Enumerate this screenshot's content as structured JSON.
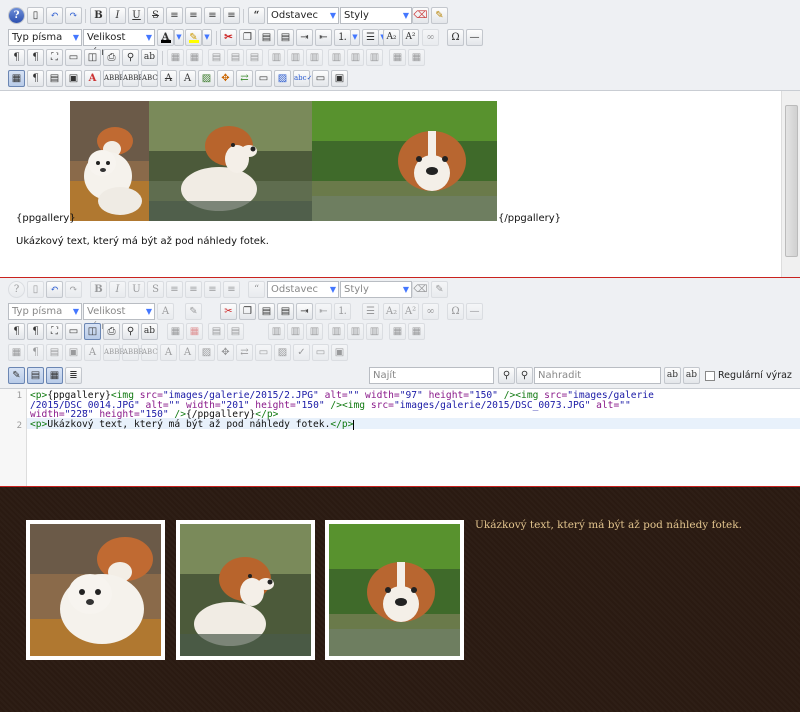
{
  "editor1": {
    "toolbar": {
      "format_select": "Odstavec",
      "styles_select": "Styly",
      "font_select": "Typ písma",
      "size_select": "Velikost písma"
    },
    "content": {
      "gallery_open_tag": "{ppgallery}",
      "gallery_close_tag": "{/ppgallery}",
      "sample_text": "Ukázkový text, který má být až pod náhledy fotek."
    }
  },
  "editor2": {
    "toolbar": {
      "format_select": "Odstavec",
      "styles_select": "Styly",
      "font_select": "Typ písma",
      "size_select": "Velikost písma"
    },
    "find": {
      "find_placeholder": "Najít",
      "replace_placeholder": "Nahradit",
      "regex_label": "Regulární výraz"
    },
    "code": {
      "line1_number": "1",
      "line2_number": "2",
      "l1a_1": "<p>",
      "l1a_2": "{ppgallery}",
      "l1a_3": "<img ",
      "l1a_4": "src=",
      "l1a_5": "\"images/galerie/2015/2.JPG\"",
      "l1a_6": " alt=",
      "l1a_7": "\"\"",
      "l1a_8": " width=",
      "l1a_9": "\"97\"",
      "l1a_10": " height=",
      "l1a_11": "\"150\"",
      "l1a_12": " />",
      "l1a_13": "<img ",
      "l1a_14": "src=",
      "l1a_15": "\"images/galerie",
      "l1b_1": "/2015/DSC_0014.JPG\"",
      "l1b_2": " alt=",
      "l1b_3": "\"\"",
      "l1b_4": " width=",
      "l1b_5": "\"201\"",
      "l1b_6": " height=",
      "l1b_7": "\"150\"",
      "l1b_8": " />",
      "l1b_9": "<img ",
      "l1b_10": "src=",
      "l1b_11": "\"images/galerie/2015/DSC_0073.JPG\"",
      "l1b_12": " alt=",
      "l1b_13": "\"\"",
      "l1c_1": "width=",
      "l1c_2": "\"228\"",
      "l1c_3": " height=",
      "l1c_4": "\"150\"",
      "l1c_5": " />",
      "l1c_6": "{/ppgallery}",
      "l1c_7": "</p>",
      "l2_1": "<p>",
      "l2_2": "Ukázkový text, který má být až pod náhledy fotek.",
      "l2_3": "</p>"
    }
  },
  "preview": {
    "sample_text": "Ukázkový text, který má být až pod náhledy fotek."
  },
  "colors": {
    "separator": "#c9221e",
    "preview_bg": "#2b1b12",
    "preview_text": "#e2c48e"
  }
}
